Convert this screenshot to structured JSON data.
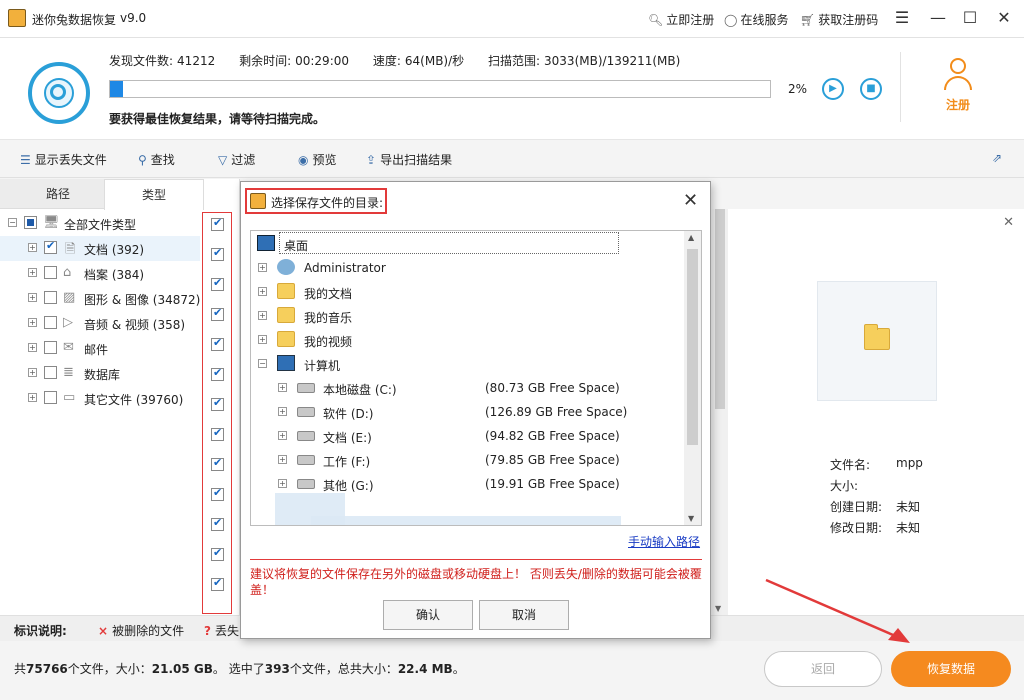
{
  "app": {
    "title": "迷你兔数据恢复",
    "version": "v9.0"
  },
  "titlebar": {
    "register_now": "立即注册",
    "online_service": "在线服务",
    "get_code": "获取注册码"
  },
  "scan": {
    "found_label": "发现文件数:",
    "found_value": "41212",
    "remaining_label": "剩余时间:",
    "remaining_value": "00:29:00",
    "speed_label": "速度:",
    "speed_value": "64(MB)/秒",
    "range_label": "扫描范围:",
    "range_value": "3033(MB)/139211(MB)",
    "progress_percent": 2,
    "progress_text": "2%",
    "hint": "要获得最佳恢复结果，请等待扫描完成。"
  },
  "register": {
    "label": "注册",
    "color": "#f28c1a"
  },
  "toolbar": {
    "show_lost": "显示丢失文件",
    "find": "查找",
    "filter": "过滤",
    "preview": "预览",
    "export": "导出扫描结果"
  },
  "tabs": {
    "path": "路径",
    "type": "类型"
  },
  "tree": {
    "root": "全部文件类型",
    "items": [
      {
        "label": "文档 (392)",
        "checked": true
      },
      {
        "label": "档案 (384)",
        "checked": false
      },
      {
        "label": "图形 & 图像 (34872)",
        "checked": false
      },
      {
        "label": "音频 & 视频 (358)",
        "checked": false
      },
      {
        "label": "邮件",
        "checked": false
      },
      {
        "label": "数据库",
        "checked": false
      },
      {
        "label": "其它文件 (39760)",
        "checked": false
      }
    ]
  },
  "details": {
    "name_label": "文件名:",
    "name_value": "mpp",
    "size_label": "大小:",
    "size_value": "",
    "created_label": "创建日期:",
    "created_value": "未知",
    "modified_label": "修改日期:",
    "modified_value": "未知"
  },
  "legend": {
    "title": "标识说明:",
    "deleted": "被删除的文件",
    "lost_prefix": "丢失"
  },
  "status": {
    "total_pre": "共",
    "total_files": "75766",
    "total_mid": "个文件，大小：",
    "total_size": "21.05 GB",
    "sel_pre": "。 选中了",
    "sel_files": "393",
    "sel_mid": "个文件，总共大小：",
    "sel_size": "22.4 MB",
    "sel_end": "。"
  },
  "buttons": {
    "back": "返回",
    "recover": "恢复数据"
  },
  "dialog": {
    "title": "选择保存文件的目录:",
    "root": "桌面",
    "nodes": [
      {
        "label": "Administrator",
        "icon": "user-icon"
      },
      {
        "label": "我的文档",
        "icon": "folder-icon"
      },
      {
        "label": "我的音乐",
        "icon": "folder-icon"
      },
      {
        "label": "我的视频",
        "icon": "folder-icon"
      },
      {
        "label": "计算机",
        "icon": "computer-icon"
      }
    ],
    "drives": [
      {
        "label": "本地磁盘 (C:)",
        "free": "(80.73 GB Free Space)"
      },
      {
        "label": "软件 (D:)",
        "free": "(126.89 GB Free Space)"
      },
      {
        "label": "文档 (E:)",
        "free": "(94.82 GB Free Space)"
      },
      {
        "label": "工作 (F:)",
        "free": "(79.85 GB Free Space)"
      },
      {
        "label": "其他 (G:)",
        "free": "(19.91 GB Free Space)"
      }
    ],
    "manual_path": "手动输入路径",
    "warning": "建议将恢复的文件保存在另外的磁盘或移动硬盘上！ 否则丢失/删除的数据可能会被覆盖！",
    "ok": "确认",
    "cancel": "取消"
  }
}
